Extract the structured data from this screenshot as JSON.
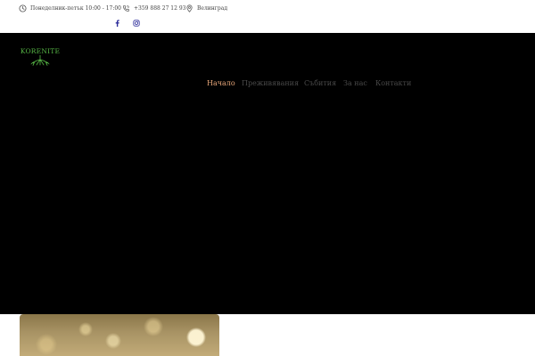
{
  "topbar": {
    "hours": "Понеделник-петък 10:00 - 17:00",
    "phone": "+359 888 27 12 93",
    "location": "Велинград"
  },
  "icons": {
    "clock": "clock-icon",
    "phone": "phone-icon",
    "location": "location-pin-icon",
    "facebook": "facebook-icon",
    "instagram": "instagram-icon"
  },
  "logo": {
    "text": "KORENITE"
  },
  "nav": {
    "items": [
      {
        "label": "Начало",
        "active": true
      },
      {
        "label": "Преживявания",
        "active": false
      },
      {
        "label": "Събития",
        "active": false
      },
      {
        "label": "За нас",
        "active": false
      },
      {
        "label": "Контакти",
        "active": false
      }
    ]
  },
  "colors": {
    "logo_green": "#57b846",
    "nav_active": "#e8a77a",
    "nav_inactive": "#4a4a4a",
    "hero_bg": "#000000",
    "social_icon": "#2c2c9a"
  }
}
